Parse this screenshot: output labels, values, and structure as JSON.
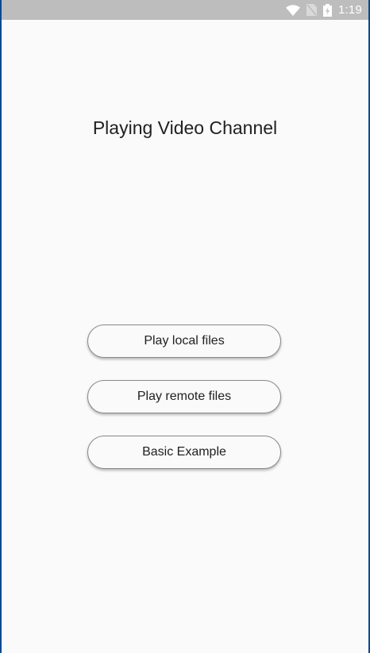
{
  "status_bar": {
    "time": "1:19",
    "icons": [
      "wifi-icon",
      "no-sim-icon",
      "battery-icon"
    ]
  },
  "main": {
    "title": "Playing Video Channel",
    "buttons": [
      {
        "label": "Play local files"
      },
      {
        "label": "Play remote files"
      },
      {
        "label": "Basic Example"
      }
    ]
  },
  "colors": {
    "background": "#fafafa",
    "status_bar": "#bdbdbd",
    "text": "#212121",
    "frame": "#0b4a8f"
  }
}
